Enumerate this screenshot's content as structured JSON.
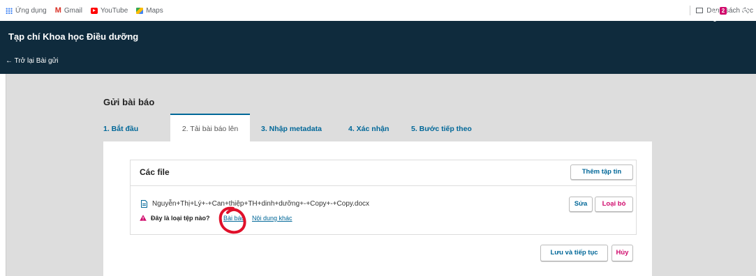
{
  "bookmarks": [
    {
      "label": "Ứng dụng",
      "icon": "apps-grid-icon"
    },
    {
      "label": "Gmail",
      "icon": "gmail-icon"
    },
    {
      "label": "YouTube",
      "icon": "youtube-icon"
    },
    {
      "label": "Maps",
      "icon": "maps-icon"
    }
  ],
  "reading_list": {
    "label": "Danh sách đọc",
    "icon": "reading-list-icon"
  },
  "header": {
    "site_title": "Tạp chí Khoa học Điều dưỡng",
    "back_link": "← Trở lại Bài gửi",
    "notification_count": "2",
    "bg_color": "#0f2b3d"
  },
  "page_title": "Gửi bài báo",
  "tabs": [
    {
      "label": "1. Bắt đầu",
      "active": false
    },
    {
      "label": "2. Tải bài báo lên",
      "active": true
    },
    {
      "label": "3. Nhập metadata",
      "active": false
    },
    {
      "label": "4. Xác nhận",
      "active": false
    },
    {
      "label": "5. Bước tiếp theo",
      "active": false
    }
  ],
  "files": {
    "title": "Các file",
    "add_button": "Thêm tập tin",
    "file_name": "Nguyễn+Thị+Lý+-+Can+thiệp+TH+dinh+dưỡng+-+Copy+-+Copy.docx",
    "edit_button": "Sửa",
    "remove_button": "Loại bỏ",
    "file_type_question": "Đây là loại tệp nào?",
    "type_options": [
      "Bài báo",
      "Nội dung khác"
    ]
  },
  "actions": {
    "save_continue": "Lưu và tiếp tục",
    "cancel": "Hủy"
  },
  "colors": {
    "accent": "#006798",
    "danger": "#d00a6c",
    "annotation": "#e0102a"
  }
}
